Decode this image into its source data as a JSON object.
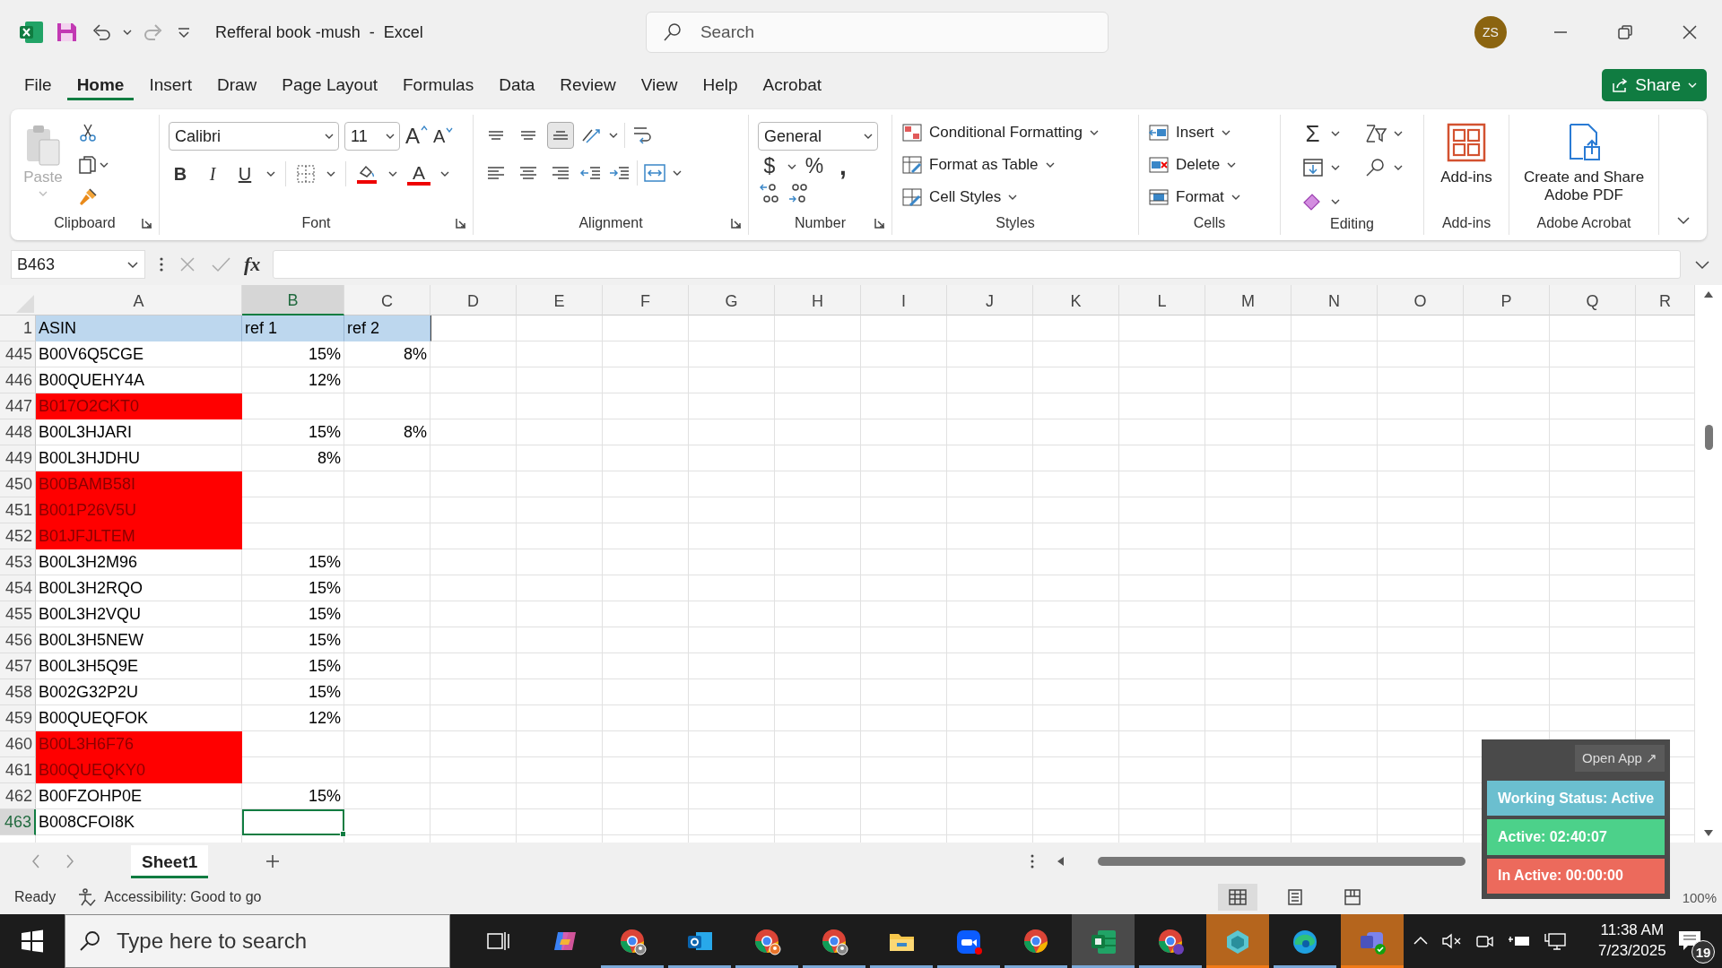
{
  "title_bar": {
    "document_title": "Refferal book -mush  -  Excel",
    "redo_disabled": true,
    "search": {
      "placeholder": "Search"
    },
    "avatar": "ZS"
  },
  "menu_tabs": [
    {
      "label": "File",
      "selected": false
    },
    {
      "label": "Home",
      "selected": true
    },
    {
      "label": "Insert",
      "selected": false
    },
    {
      "label": "Draw",
      "selected": false
    },
    {
      "label": "Page Layout",
      "selected": false
    },
    {
      "label": "Formulas",
      "selected": false
    },
    {
      "label": "Data",
      "selected": false
    },
    {
      "label": "Review",
      "selected": false
    },
    {
      "label": "View",
      "selected": false
    },
    {
      "label": "Help",
      "selected": false
    },
    {
      "label": "Acrobat",
      "selected": false
    }
  ],
  "share_button": "Share",
  "ribbon": {
    "clipboard": {
      "paste": "Paste",
      "paste_disabled": true,
      "label": "Clipboard"
    },
    "font": {
      "font_name": "Calibri",
      "font_size": "11",
      "grow": "A",
      "shrink": "A",
      "bold": "B",
      "italic": "I",
      "underline": "U",
      "font_color": "A",
      "label": "Font"
    },
    "alignment": {
      "vertical_align_buttons": [
        {
          "selected": false
        },
        {
          "selected": false
        },
        {
          "selected": true
        }
      ],
      "label": "Alignment"
    },
    "number": {
      "format": "General",
      "currency": "$",
      "percent": "%",
      "comma": ",",
      "label": "Number"
    },
    "styles": {
      "buttons": [
        "Conditional Formatting",
        "Format as Table",
        "Cell Styles"
      ],
      "label": "Styles"
    },
    "cells": {
      "buttons": [
        "Insert",
        "Delete",
        "Format"
      ],
      "label": "Cells"
    },
    "editing": {
      "sum": "Σ",
      "label": "Editing"
    },
    "add_ins": {
      "button": "Add-ins",
      "label": "Add-ins"
    },
    "acrobat": {
      "button": "Create and Share Adobe PDF",
      "label": "Adobe Acrobat"
    }
  },
  "formula_bar": {
    "name_box": "B463",
    "function_label": "fx"
  },
  "grid": {
    "columns": [
      {
        "label": "A",
        "selected": false
      },
      {
        "label": "B",
        "selected": true
      },
      {
        "label": "C",
        "selected": false
      },
      {
        "label": "D",
        "selected": false
      },
      {
        "label": "E",
        "selected": false
      },
      {
        "label": "F",
        "selected": false
      },
      {
        "label": "G",
        "selected": false
      },
      {
        "label": "H",
        "selected": false
      },
      {
        "label": "I",
        "selected": false
      },
      {
        "label": "J",
        "selected": false
      },
      {
        "label": "K",
        "selected": false
      },
      {
        "label": "L",
        "selected": false
      },
      {
        "label": "M",
        "selected": false
      },
      {
        "label": "N",
        "selected": false
      },
      {
        "label": "O",
        "selected": false
      },
      {
        "label": "P",
        "selected": false
      },
      {
        "label": "Q",
        "selected": false
      },
      {
        "label": "R",
        "selected": false
      }
    ],
    "header_row": {
      "number": "1",
      "cells": [
        "ASIN",
        "ref 1",
        "ref 2"
      ]
    },
    "rows": [
      {
        "number": "445",
        "asin": "B00V6Q5CGE",
        "ref_1": "15%",
        "ref_2": "8%",
        "highlighted": false,
        "selected": false
      },
      {
        "number": "446",
        "asin": "B00QUEHY4A",
        "ref_1": "12%",
        "highlighted": false,
        "selected": false
      },
      {
        "number": "447",
        "asin": "B017O2CKT0",
        "highlighted": true,
        "selected": false
      },
      {
        "number": "448",
        "asin": "B00L3HJARI",
        "ref_1": "15%",
        "ref_2": "8%",
        "highlighted": false,
        "selected": false
      },
      {
        "number": "449",
        "asin": "B00L3HJDHU",
        "ref_1": "8%",
        "highlighted": false,
        "selected": false
      },
      {
        "number": "450",
        "asin": "B00BAMB58I",
        "highlighted": true,
        "selected": false
      },
      {
        "number": "451",
        "asin": "B001P26V5U",
        "highlighted": true,
        "selected": false
      },
      {
        "number": "452",
        "asin": "B01JFJLTEM",
        "highlighted": true,
        "selected": false
      },
      {
        "number": "453",
        "asin": "B00L3H2M96",
        "ref_1": "15%",
        "highlighted": false,
        "selected": false
      },
      {
        "number": "454",
        "asin": "B00L3H2RQO",
        "ref_1": "15%",
        "highlighted": false,
        "selected": false
      },
      {
        "number": "455",
        "asin": "B00L3H2VQU",
        "ref_1": "15%",
        "highlighted": false,
        "selected": false
      },
      {
        "number": "456",
        "asin": "B00L3H5NEW",
        "ref_1": "15%",
        "highlighted": false,
        "selected": false
      },
      {
        "number": "457",
        "asin": "B00L3H5Q9E",
        "ref_1": "15%",
        "highlighted": false,
        "selected": false
      },
      {
        "number": "458",
        "asin": "B002G32P2U",
        "ref_1": "15%",
        "highlighted": false,
        "selected": false
      },
      {
        "number": "459",
        "asin": "B00QUEQFOK",
        "ref_1": "12%",
        "highlighted": false,
        "selected": false
      },
      {
        "number": "460",
        "asin": "B00L3H6F76",
        "highlighted": true,
        "selected": false
      },
      {
        "number": "461",
        "asin": "B00QUEQKY0",
        "highlighted": true,
        "selected": false
      },
      {
        "number": "462",
        "asin": "B00FZOHP0E",
        "ref_1": "15%",
        "highlighted": false,
        "selected": false
      },
      {
        "number": "463",
        "asin": "B008CFOI8K",
        "highlighted": false,
        "selected": true
      }
    ]
  },
  "sheet_tabs": [
    {
      "label": "Sheet1",
      "selected": true
    }
  ],
  "status_bar": {
    "status": "Ready",
    "accessibility": "Accessibility: Good to go",
    "zoom": "100%"
  },
  "tracker_widget": {
    "open_button": "Open App ↗",
    "bars": [
      {
        "text": "Working Status: Active",
        "color": "#6bbfcf"
      },
      {
        "text": "Active: 02:40:07",
        "color": "#4cd18a"
      },
      {
        "text": "In Active: 00:00:00",
        "color": "#ec6a5c"
      }
    ]
  },
  "taskbar": {
    "search": {
      "placeholder": "Type here to search"
    },
    "apps": [
      {
        "kind": "task-view",
        "running": false,
        "active": false,
        "attention": false
      },
      {
        "kind": "copilot",
        "running": false,
        "active": false,
        "attention": false
      },
      {
        "kind": "browser-profile",
        "running": true,
        "active": false,
        "attention": false
      },
      {
        "kind": "mail",
        "running": true,
        "active": false,
        "attention": false
      },
      {
        "kind": "browser-orange",
        "running": true,
        "active": false,
        "attention": false
      },
      {
        "kind": "browser-profile",
        "running": true,
        "active": false,
        "attention": false
      },
      {
        "kind": "folder",
        "running": true,
        "active": false,
        "attention": false
      },
      {
        "kind": "video",
        "running": true,
        "active": false,
        "attention": false
      },
      {
        "kind": "browser",
        "running": true,
        "active": false,
        "attention": false
      },
      {
        "kind": "spreadsheet",
        "running": true,
        "active": true,
        "attention": false
      },
      {
        "kind": "browser-badge",
        "running": true,
        "active": false,
        "attention": false
      },
      {
        "kind": "cube",
        "running": true,
        "active": false,
        "attention": true
      },
      {
        "kind": "edge",
        "running": true,
        "active": false,
        "attention": false
      },
      {
        "kind": "teams",
        "running": true,
        "active": false,
        "attention": true
      }
    ],
    "time": "11:38 AM",
    "date": "7/23/2025",
    "notifications": "19"
  }
}
